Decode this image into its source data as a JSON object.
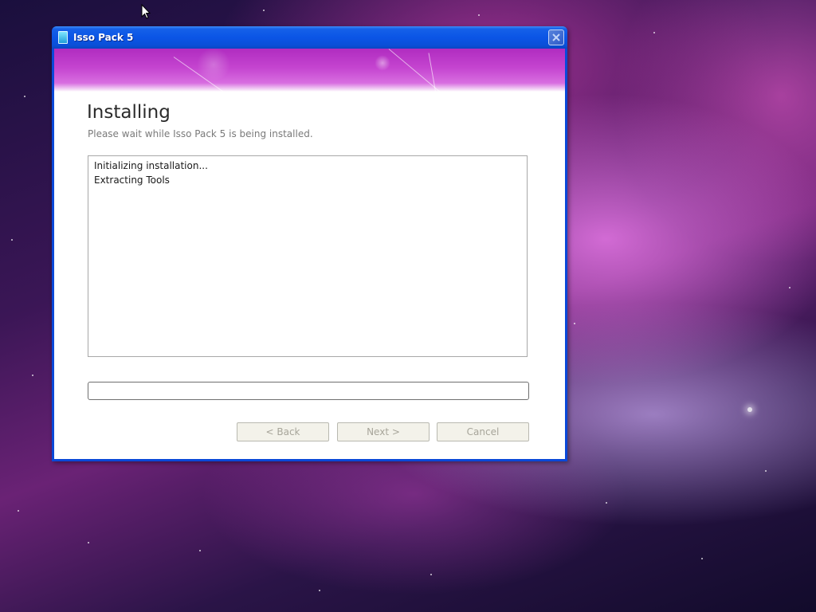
{
  "window": {
    "title": "Isso Pack 5",
    "close_icon": "close-icon"
  },
  "page": {
    "heading": "Installing",
    "subheading": "Please wait while Isso Pack 5 is being installed."
  },
  "log": {
    "lines": [
      "Initializing installation...",
      "Extracting Tools"
    ]
  },
  "progress": {
    "value": 0
  },
  "buttons": {
    "back": "< Back",
    "next": "Next >",
    "cancel": "Cancel"
  },
  "colors": {
    "titlebar": "#0b55e6",
    "banner": "#c545d0",
    "progress_fill": "#2ec24a"
  }
}
